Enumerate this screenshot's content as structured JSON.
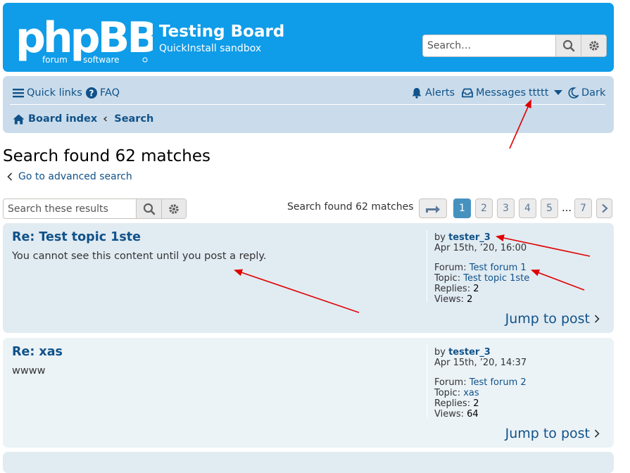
{
  "header": {
    "logo_text": "phpBB",
    "logo_sub_left": "forum",
    "logo_sub_right": "software",
    "site_title": "Testing Board",
    "site_description": "QuickInstall sandbox",
    "search_placeholder": "Search…"
  },
  "nav": {
    "quick_links": "Quick links",
    "faq": "FAQ",
    "alerts": "Alerts",
    "messages": "Messages",
    "username": "ttttt",
    "dark": "Dark",
    "breadcrumb": {
      "board_index": "Board index",
      "search": "Search"
    }
  },
  "page": {
    "title": "Search found 62 matches",
    "advanced_link": "Go to advanced search"
  },
  "action_bar": {
    "results_placeholder": "Search these results",
    "found_text": "Search found 62 matches",
    "pages": [
      "1",
      "2",
      "3",
      "4",
      "5"
    ],
    "last_page": "7",
    "ellipsis": "…",
    "current_page": "1"
  },
  "posts": [
    {
      "title": "Re: Test topic 1ste",
      "body": "You cannot see this content until you post a reply.",
      "by_label": "by",
      "author": "tester_3",
      "date": "Apr 15th, ’20, 16:00",
      "forum_label": "Forum:",
      "forum": "Test forum 1",
      "topic_label": "Topic:",
      "topic": "Test topic 1ste",
      "replies_label": "Replies:",
      "replies": "2",
      "views_label": "Views:",
      "views": "2",
      "jump": "Jump to post"
    },
    {
      "title": "Re: xas",
      "body": "wwww",
      "by_label": "by",
      "author": "tester_3",
      "date": "Apr 15th, ’20, 14:37",
      "forum_label": "Forum:",
      "forum": "Test forum 2",
      "topic_label": "Topic:",
      "topic": "xas",
      "replies_label": "Replies:",
      "replies": "2",
      "views_label": "Views:",
      "views": "64",
      "jump": "Jump to post"
    }
  ],
  "colors": {
    "header_bg": "#0f9ce8",
    "navbar_bg": "#cadceb",
    "link": "#105289",
    "post_bg1": "#e1ebf2",
    "post_bg2": "#ecf3f7",
    "pagination_active": "#4692bf",
    "annotation_arrow": "#e00000"
  }
}
